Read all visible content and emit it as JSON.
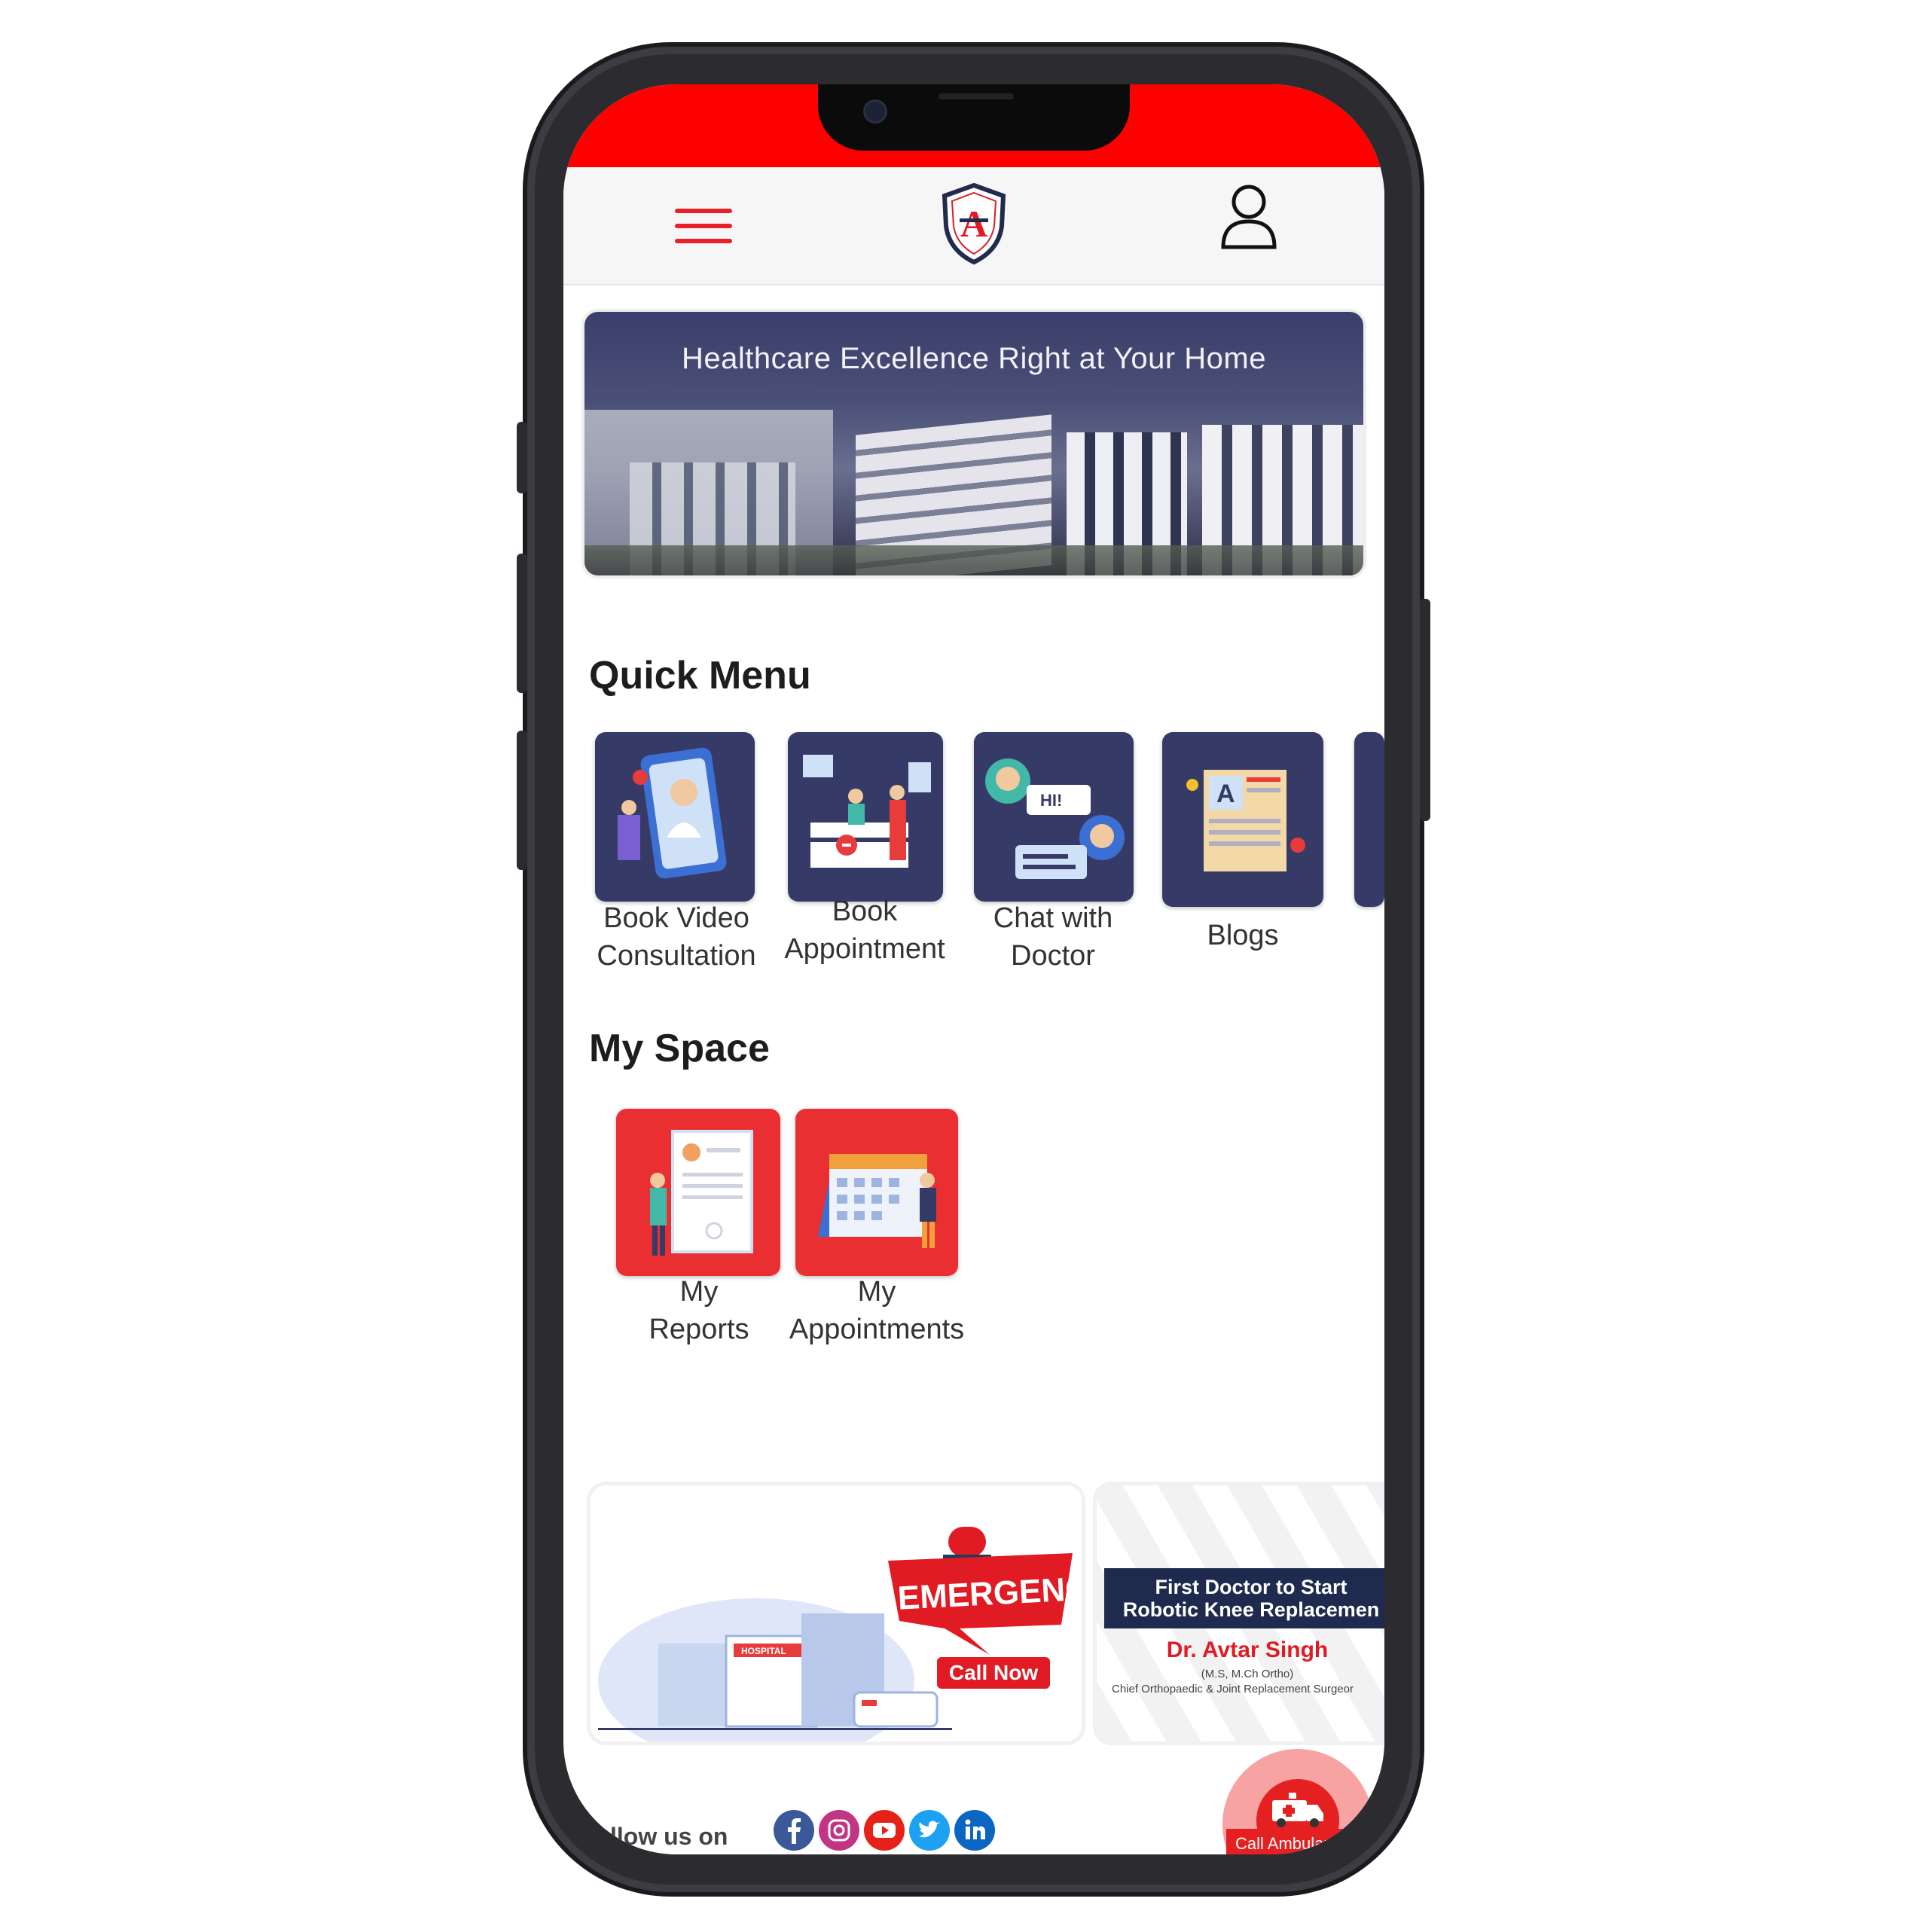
{
  "colors": {
    "brand_red": "#ff0000",
    "accent_red": "#ea2f33",
    "tile_navy": "#363a66"
  },
  "header": {
    "menu_icon": "hamburger-icon",
    "logo_text": "A",
    "profile_icon": "user-icon"
  },
  "hero": {
    "title": "Healthcare Excellence Right at Your Home"
  },
  "quick_menu": {
    "title": "Quick Menu",
    "items": [
      {
        "line1": "Book Video",
        "line2": "Consultation"
      },
      {
        "line1": "Book",
        "line2": "Appointment"
      },
      {
        "line1": "Chat with",
        "line2": "Doctor"
      },
      {
        "line1": "Blogs",
        "line2": ""
      }
    ]
  },
  "my_space": {
    "title": "My Space",
    "items": [
      {
        "line1": "My",
        "line2": "Reports"
      },
      {
        "line1": "My",
        "line2": "Appointments"
      }
    ]
  },
  "banners": {
    "emergency": {
      "title": "EMERGENCY",
      "cta": "Call Now",
      "hospital_sign": "HOSPITAL"
    },
    "doctor": {
      "headline1": "First Doctor to Start",
      "headline2": "Robotic Knee Replacemen",
      "name": "Dr. Avtar Singh",
      "quals": "(M.S, M.Ch Ortho)",
      "role": "Chief Orthopaedic & Joint Replacement Surgeor"
    }
  },
  "footer": {
    "follow_text": "llow us on",
    "social": [
      "facebook-icon",
      "instagram-icon",
      "youtube-icon",
      "twitter-icon",
      "linkedin-icon"
    ],
    "ambulance_label": "Call Ambular"
  }
}
